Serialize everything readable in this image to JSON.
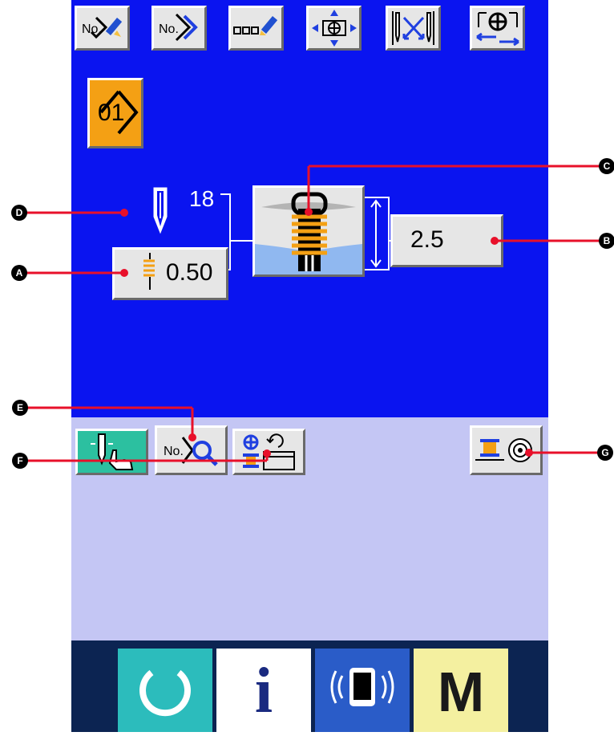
{
  "toolbar": {
    "buttons": [
      {
        "icon": "number-edit-icon",
        "label": "No."
      },
      {
        "icon": "number-next-icon",
        "label": "No."
      },
      {
        "icon": "text-edit-icon",
        "label": ""
      },
      {
        "icon": "move-arrows-icon",
        "label": ""
      },
      {
        "icon": "needle-swap-icon",
        "label": ""
      },
      {
        "icon": "presser-rotate-icon",
        "label": ""
      }
    ]
  },
  "pattern_number": "01",
  "needle_count": "18",
  "needle_gauge_value": "0.50",
  "stitch_value": "2.5",
  "mid_buttons": {
    "needle_hand": "",
    "number_search": "No.",
    "bobbin_winder": "",
    "bobbin_counter": ""
  },
  "markers": {
    "a": "A",
    "b": "B",
    "c": "C",
    "d": "D",
    "e": "E",
    "f": "F",
    "g": "G"
  },
  "bottom": {
    "reset_icon": "reset-icon",
    "info_label": "i",
    "comm_icon": "communication-icon",
    "mode_label": "M"
  },
  "colors": {
    "screen_top": "#0a14f0",
    "screen_mid": "#c4c6f4",
    "screen_bottom": "#0c2452",
    "accent_orange": "#f4a014",
    "marker_red": "#e8102a"
  }
}
